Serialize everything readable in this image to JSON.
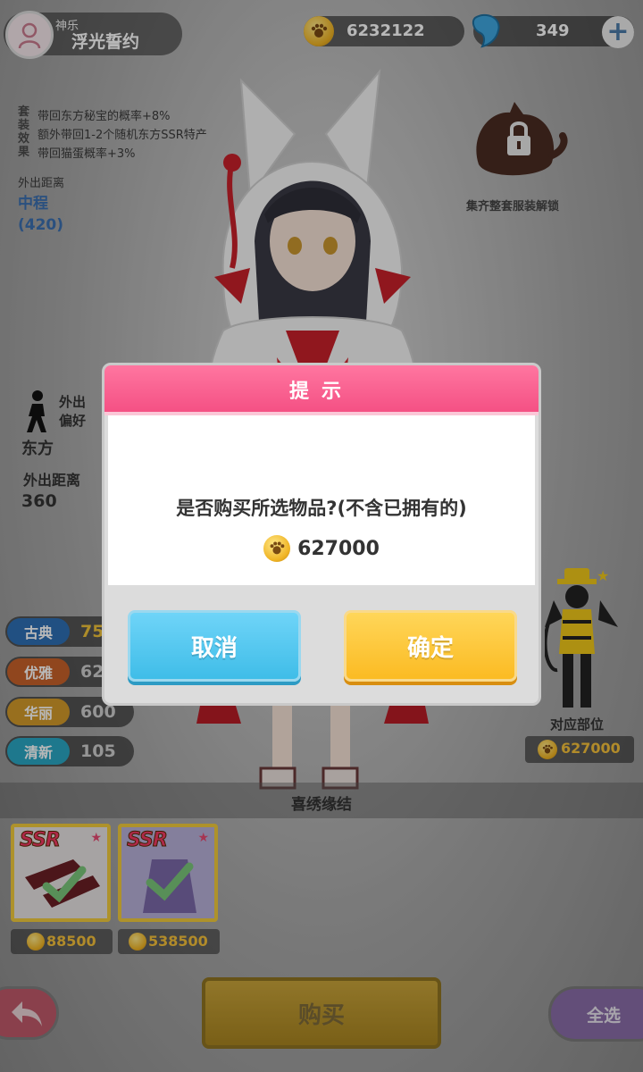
{
  "header": {
    "subtitle": "神乐",
    "title": "浮光誓约",
    "coins": "6232122",
    "gems": "349"
  },
  "set_effects": {
    "label": "套装效果",
    "lines": [
      "带回东方秘宝的概率+8%",
      "额外带回1-2个随机东方SSR特产",
      "带回猫蛋概率+3%"
    ],
    "distance_label": "外出距离",
    "distance_value": "中程",
    "distance_number": "(420)"
  },
  "locked": {
    "label": "集齐整套服装解锁"
  },
  "preference": {
    "label": "外出偏好",
    "value": "东方",
    "distance_label": "外出距离",
    "distance_value": "360"
  },
  "stats": [
    {
      "name": "古典",
      "value": "75",
      "color": "#2f6fb5",
      "value_color": "#f0c23a"
    },
    {
      "name": "优雅",
      "value": "62",
      "color": "#c8622a",
      "value_color": "#cfcfcf"
    },
    {
      "name": "华丽",
      "value": "600",
      "color": "#d39a2a",
      "value_color": "#cfcfcf"
    },
    {
      "name": "清新",
      "value": "105",
      "color": "#2aa7c4",
      "value_color": "#cfcfcf"
    }
  ],
  "part": {
    "label": "对应部位",
    "price": "627000"
  },
  "suit": {
    "name": "喜绣缘结",
    "items": [
      {
        "rarity": "SSR",
        "price": "88500"
      },
      {
        "rarity": "SSR",
        "price": "538500"
      }
    ]
  },
  "buttons": {
    "buy": "购买",
    "select_all": "全选"
  },
  "dialog": {
    "title": "提示",
    "message": "是否购买所选物品?(不含已拥有的)",
    "price": "627000",
    "cancel": "取消",
    "confirm": "确定"
  }
}
